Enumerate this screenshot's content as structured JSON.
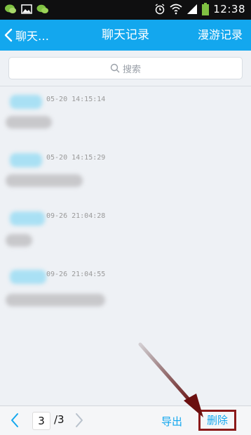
{
  "status_bar": {
    "time": "12:38",
    "icons": [
      "wechat-like-icon",
      "image-icon",
      "wechat-icon",
      "alarm-icon",
      "wifi-icon",
      "signal-icon",
      "battery-icon"
    ]
  },
  "nav": {
    "back_label": "聊天…",
    "title": "聊天记录",
    "right_label": "漫游记录"
  },
  "search": {
    "placeholder": "搜索"
  },
  "messages": [
    {
      "time": "05-20 14:15:14"
    },
    {
      "time": "05-20 14:15:29"
    },
    {
      "time": "09-26 21:04:28"
    },
    {
      "time": "09-26 21:04:55"
    }
  ],
  "pager": {
    "current": "3",
    "total": "/3"
  },
  "actions": {
    "export_label": "导出",
    "delete_label": "删除"
  },
  "colors": {
    "accent": "#13a7ee",
    "highlight_box": "#8b1a1a"
  }
}
